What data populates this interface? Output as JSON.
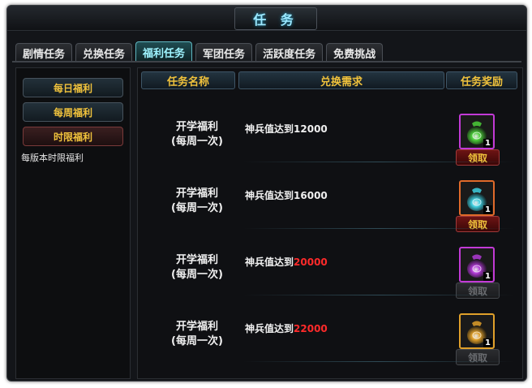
{
  "window": {
    "title": "任 务"
  },
  "tabs": [
    {
      "label": "剧情任务",
      "active": false
    },
    {
      "label": "兑换任务",
      "active": false
    },
    {
      "label": "福利任务",
      "active": true
    },
    {
      "label": "军团任务",
      "active": false
    },
    {
      "label": "活跃度任务",
      "active": false
    },
    {
      "label": "免费挑战",
      "active": false
    }
  ],
  "sidebar": {
    "items": [
      {
        "label": "每日福利",
        "active": false
      },
      {
        "label": "每周福利",
        "active": false
      },
      {
        "label": "时限福利",
        "active": true
      }
    ],
    "description": "每版本时限福利"
  },
  "table": {
    "headers": [
      "任务名称",
      "兑换需求",
      "任务奖励"
    ],
    "rows": [
      {
        "name_line1": "开学福利",
        "name_line2": "(每周一次)",
        "req_prefix": "神兵值达到",
        "req_value": "12000",
        "req_value_color": "#f0f0f0",
        "reward_color": "#4ccf3a",
        "reward_border": "#c23ad6",
        "reward_count": "1",
        "claim_label": "领取",
        "claim_enabled": true
      },
      {
        "name_line1": "开学福利",
        "name_line2": "(每周一次)",
        "req_prefix": "神兵值达到",
        "req_value": "16000",
        "req_value_color": "#f0f0f0",
        "reward_color": "#3ed0e0",
        "reward_border": "#e06a2a",
        "reward_count": "1",
        "claim_label": "领取",
        "claim_enabled": true
      },
      {
        "name_line1": "开学福利",
        "name_line2": "(每周一次)",
        "req_prefix": "神兵值达到",
        "req_value": "20000",
        "req_value_color": "#ff2a2a",
        "reward_color": "#b23ad6",
        "reward_border": "#c23ad6",
        "reward_count": "1",
        "claim_label": "领取",
        "claim_enabled": false
      },
      {
        "name_line1": "开学福利",
        "name_line2": "(每周一次)",
        "req_prefix": "神兵值达到",
        "req_value": "22000",
        "req_value_color": "#ff2a2a",
        "reward_color": "#e0a02a",
        "reward_border": "#e0a02a",
        "reward_count": "1",
        "claim_label": "领取",
        "claim_enabled": false
      }
    ]
  }
}
